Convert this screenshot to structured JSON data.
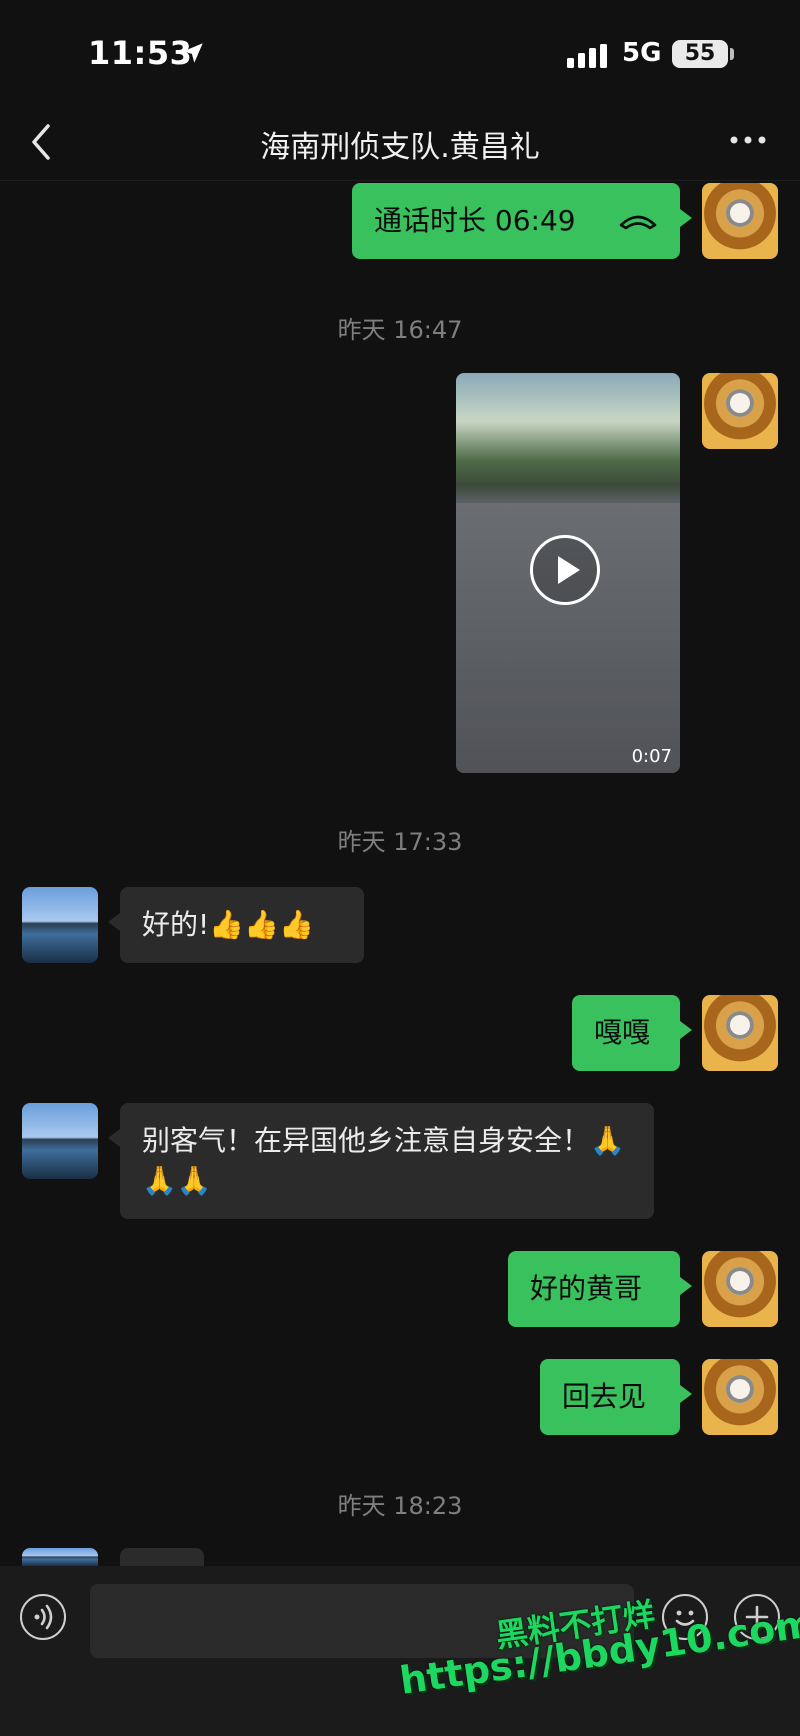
{
  "status_bar": {
    "time": "11:53",
    "network": "5G",
    "battery": "55"
  },
  "header": {
    "title": "海南刑侦支队.黄昌礼"
  },
  "messages": {
    "call": {
      "text": "通话时长 06:49"
    },
    "ts1": "昨天 16:47",
    "video": {
      "duration": "0:07"
    },
    "ts2": "昨天 17:33",
    "m1": "好的!👍👍👍",
    "m2": "嘎嘎",
    "m3": "别客气！在异国他乡注意自身安全！🙏🙏🙏",
    "m4": "好的黄哥",
    "m5": "回去见",
    "ts3": "昨天 18:23"
  },
  "input": {
    "placeholder": ""
  },
  "watermark": {
    "line1": "黑料不打烊",
    "line2": "https://bbdy10.com"
  },
  "colors": {
    "bubble_green": "#39c15d",
    "bubble_dark": "#2b2b2b",
    "background": "#111111"
  },
  "icons": [
    "location-arrow-icon",
    "signal-icon",
    "back-chevron-icon",
    "more-dots-icon",
    "phone-hangup-icon",
    "play-icon",
    "voice-icon",
    "emoji-icon",
    "plus-icon"
  ]
}
